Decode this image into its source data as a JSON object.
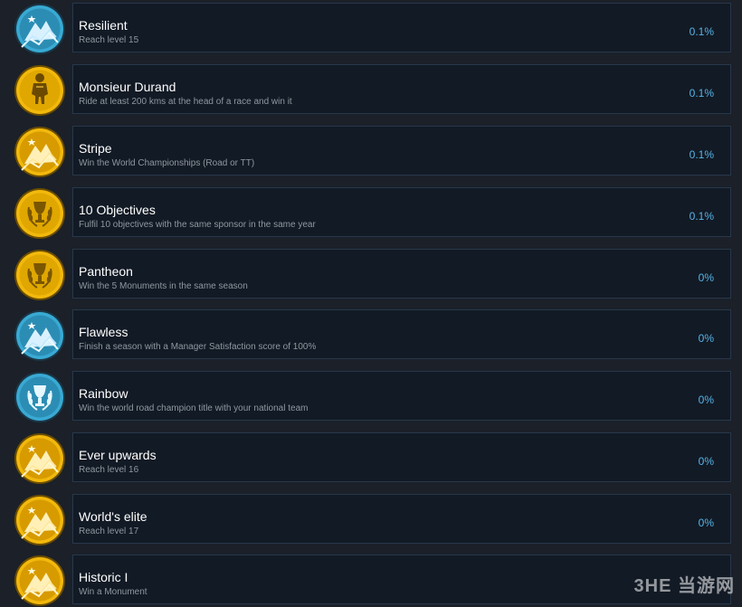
{
  "achievements": [
    {
      "title": "Resilient",
      "description": "Reach level 15",
      "percent": "0.1%",
      "icon": "blue-mountain-badge-icon",
      "color": "blue"
    },
    {
      "title": "Monsieur Durand",
      "description": "Ride at least 200 kms at the head of a race and win it",
      "percent": "0.1%",
      "icon": "gold-cyclist-badge-icon",
      "color": "gold"
    },
    {
      "title": "Stripe",
      "description": "Win the World Championships (Road or TT)",
      "percent": "0.1%",
      "icon": "gold-mountain-badge-icon",
      "color": "gold"
    },
    {
      "title": "10 Objectives",
      "description": "Fulfil 10 objectives with the same sponsor in the same year",
      "percent": "0.1%",
      "icon": "gold-laurel-trophy-badge-icon",
      "color": "gold"
    },
    {
      "title": "Pantheon",
      "description": "Win the 5 Monuments in the same season",
      "percent": "0%",
      "icon": "gold-laurel-trophy-badge-icon",
      "color": "gold"
    },
    {
      "title": "Flawless",
      "description": "Finish a season with a Manager Satisfaction score of 100%",
      "percent": "0%",
      "icon": "blue-mountain-badge-icon",
      "color": "blue"
    },
    {
      "title": "Rainbow",
      "description": "Win the world road champion title with your national team",
      "percent": "0%",
      "icon": "blue-laurel-trophy-badge-icon",
      "color": "blue"
    },
    {
      "title": "Ever upwards",
      "description": "Reach level 16",
      "percent": "0%",
      "icon": "gold-mountain-badge-icon",
      "color": "gold"
    },
    {
      "title": "World's elite",
      "description": "Reach level 17",
      "percent": "0%",
      "icon": "gold-mountain-badge-icon",
      "color": "gold"
    },
    {
      "title": "Historic I",
      "description": "Win a Monument",
      "percent": "",
      "icon": "gold-mountain-badge-icon",
      "color": "gold"
    }
  ],
  "watermark": "3HE 当游网",
  "colors": {
    "background": "#1b2029",
    "card": "#121a25",
    "card_border": "#27384b",
    "percent": "#56b4e8",
    "gold": "#f2b90d",
    "blue": "#37a7cf"
  }
}
